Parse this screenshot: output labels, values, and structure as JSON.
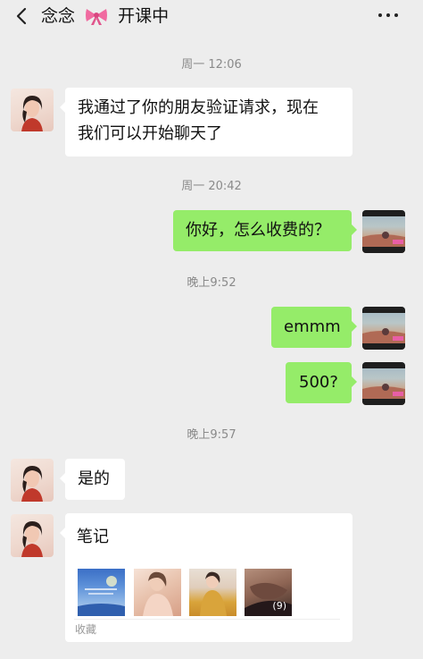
{
  "header": {
    "contact_name": "念念",
    "status": "开课中",
    "back_icon": "chevron-left-icon",
    "bow_icon": "ribbon-bow-emoji",
    "more_icon": "more-dots-icon"
  },
  "chat": {
    "time_1": "周一 12:06",
    "msg_1_line_1": "我通过了你的朋友验证请求，现在",
    "msg_1_line_2": "我们可以开始聊天了",
    "time_2": "周一 20:42",
    "msg_2": "你好，怎么收费的？",
    "time_3": "晚上9:52",
    "msg_3": "emmm",
    "msg_4": "500?",
    "time_4": "晚上9:57",
    "msg_5": "是的",
    "card": {
      "title": "笔记",
      "image_count": "(9)",
      "source": "收藏"
    }
  },
  "colors": {
    "background": "#ededed",
    "outgoing_bubble": "#95ec69",
    "incoming_bubble": "#ffffff",
    "timestamp": "#8a8a8a"
  }
}
